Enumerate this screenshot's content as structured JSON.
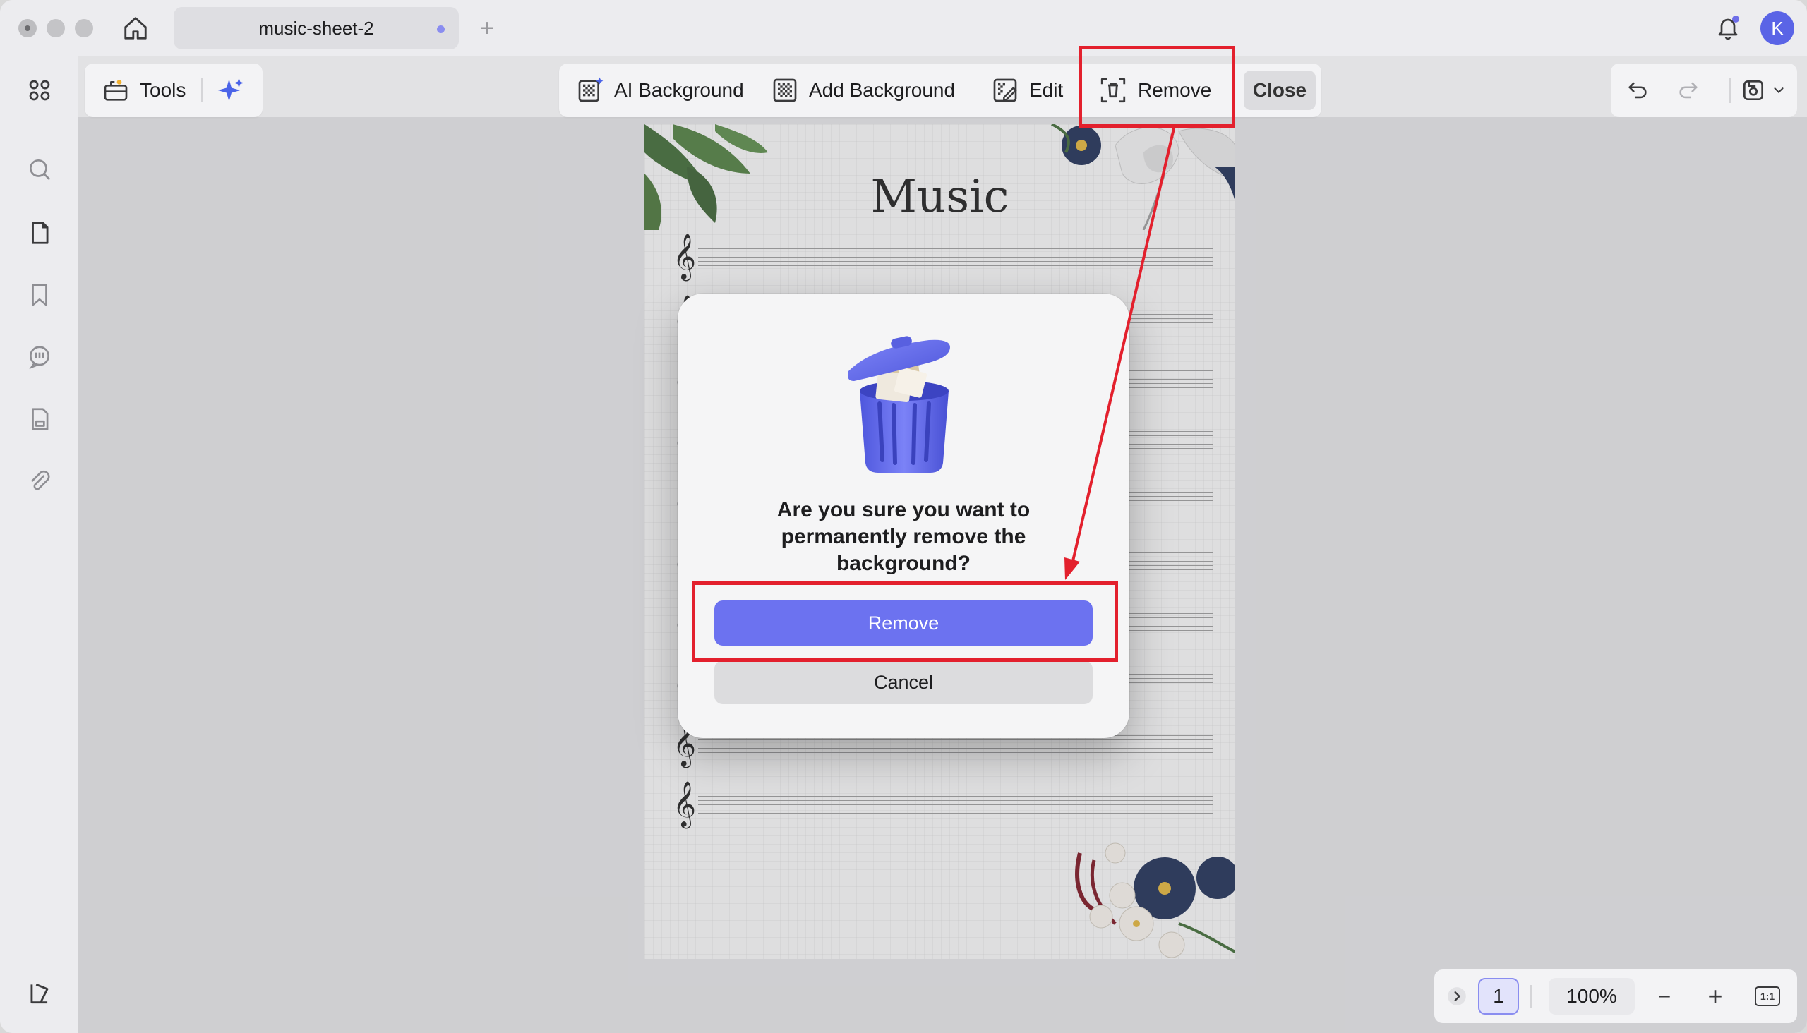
{
  "titlebar": {
    "tab_title": "music-sheet-2",
    "new_tab": "+",
    "avatar_initial": "K"
  },
  "toolbar": {
    "tools_label": "Tools",
    "ai_background_label": "AI Background",
    "add_background_label": "Add Background",
    "edit_label": "Edit",
    "remove_label": "Remove",
    "close_label": "Close"
  },
  "page": {
    "title": "Music"
  },
  "dialog": {
    "message": "Are you sure you want to permanently remove the background?",
    "confirm_label": "Remove",
    "cancel_label": "Cancel"
  },
  "zoom": {
    "page_number": "1",
    "zoom_level": "100%",
    "minus": "−",
    "plus": "+",
    "fit_label": "1:1"
  },
  "colors": {
    "accent": "#6c72f0",
    "annotation": "#e3202d",
    "avatar": "#5a64e6"
  }
}
